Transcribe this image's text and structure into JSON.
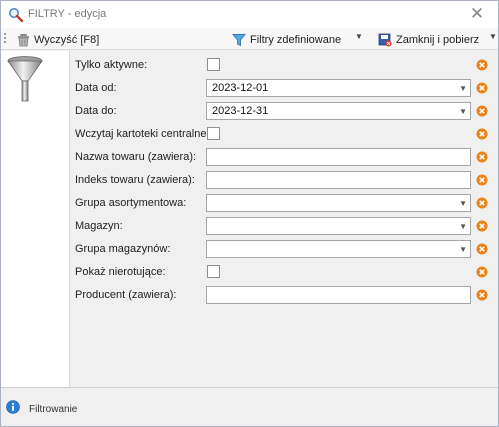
{
  "window": {
    "title": "FILTRY - edycja"
  },
  "toolbar": {
    "clear_label": "Wyczyść [F8]",
    "filters_label": "Filtry zdefiniowane",
    "close_label": "Zamknij i pobierz"
  },
  "fields": {
    "active_only": {
      "label": "Tylko aktywne:"
    },
    "date_from": {
      "label": "Data od:",
      "value": "2023-12-01"
    },
    "date_to": {
      "label": "Data do:",
      "value": "2023-12-31"
    },
    "central_records": {
      "label": "Wczytaj kartoteki centralne:"
    },
    "product_name": {
      "label": "Nazwa towaru (zawiera):",
      "value": ""
    },
    "product_index": {
      "label": "Indeks towaru (zawiera):",
      "value": ""
    },
    "assortment_group": {
      "label": "Grupa asortymentowa:",
      "value": ""
    },
    "warehouse": {
      "label": "Magazyn:",
      "value": ""
    },
    "warehouse_group": {
      "label": "Grupa magazynów:",
      "value": ""
    },
    "show_idle": {
      "label": "Pokaż nierotujące:"
    },
    "producer": {
      "label": "Producent (zawiera):",
      "value": ""
    }
  },
  "status": {
    "text": "Filtrowanie"
  },
  "colors": {
    "clear_icon": "#e8841a",
    "accent": "#2a7fd4"
  }
}
